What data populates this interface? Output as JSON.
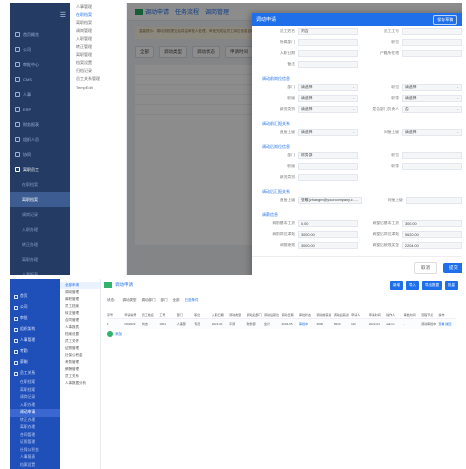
{
  "top": {
    "sidebar": {
      "items": [
        {
          "label": "首页概览"
        },
        {
          "label": "公司"
        },
        {
          "label": "审批中心"
        },
        {
          "label": "CMS"
        },
        {
          "label": "人事"
        },
        {
          "label": "ERP"
        },
        {
          "label": "财务报表"
        },
        {
          "label": "组织人员"
        },
        {
          "label": "协同"
        },
        {
          "label": "离职员工"
        }
      ],
      "subitems": [
        {
          "label": "在职档案"
        },
        {
          "label": "离职档案"
        },
        {
          "label": "调岗记录"
        },
        {
          "label": "入职办理"
        },
        {
          "label": "转正办理"
        },
        {
          "label": "离职办理"
        },
        {
          "label": "人事报表"
        },
        {
          "label": "合同管理"
        },
        {
          "label": "证照管理"
        },
        {
          "label": "社保公积金"
        },
        {
          "label": "考勤管理"
        }
      ]
    },
    "submenu": [
      "人事管理",
      "在职档案",
      "离职档案",
      "调岗管理",
      "入职管理",
      "转正管理",
      "离职管理",
      "档案设置",
      "归档记录",
      "员工关系管理",
      "TempEdit"
    ],
    "tabs": [
      {
        "label": "调动申请"
      },
      {
        "label": "任务流程"
      },
      {
        "label": "调岗管理"
      }
    ],
    "notice": "温馨提示：调动流程提交后将由审批人处理，审批完成后员工岗位信息自动更新，如需修改请撤回后重新提交。",
    "filters": [
      "全部",
      "调动类型",
      "调动状态",
      "申请时间"
    ],
    "drawer": {
      "title": "调动申请",
      "header_button": "保存草稿",
      "close": "✕",
      "top_fields": [
        {
          "label": "员工姓名",
          "value": "刘吉",
          "label2": "员工工号",
          "value2": ""
        },
        {
          "label": "所属部门",
          "value": "",
          "label2": "职位",
          "value2": ""
        },
        {
          "label": "入职日期",
          "value": "",
          "label2": "户籍所在地",
          "value2": ""
        },
        {
          "label": "备注",
          "value": "",
          "label2": "",
          "value2": ""
        }
      ],
      "sections": [
        {
          "title": "调动前岗位信息",
          "rows": [
            {
              "label": "部门",
              "value": "请选择",
              "select": true,
              "label2": "职位",
              "value2": "请选择",
              "select2": true
            },
            {
              "label": "职级",
              "value": "请选择",
              "select": true,
              "label2": "职等",
              "value2": "请选择",
              "select2": true
            },
            {
              "label": "薪资类别",
              "value": "请选择",
              "select": true,
              "label2": "是否部门负责人",
              "value2": "否",
              "select2": true
            }
          ]
        },
        {
          "title": "调动前汇报关系",
          "rows": [
            {
              "label": "直接上级",
              "value": "请选择",
              "select": true,
              "label2": "间接上级",
              "value2": "请选择",
              "select2": true
            }
          ]
        },
        {
          "title": "调动后岗位信息",
          "rows": [
            {
              "label": "部门",
              "value": "财务部",
              "select": false,
              "label2": "职位",
              "value2": "",
              "select2": false
            },
            {
              "label": "职级",
              "value": "",
              "select": false,
              "label2": "职等",
              "value2": "",
              "select2": false
            },
            {
              "label": "薪资类别",
              "value": "",
              "select": false,
              "label2": "",
              "value2": "",
              "select2": false
            }
          ]
        },
        {
          "title": "调动后汇报关系",
          "rows": [
            {
              "label": "直接上级",
              "value": "张敏(zhangm@yourcompany.c...",
              "select": true,
              "label2": "间接上级",
              "value2": "",
              "select2": false
            }
          ]
        },
        {
          "title": "调薪信息",
          "rows": [
            {
              "label": "调前基本工资",
              "value": "0.00",
              "select": false,
              "label2": "调整后基本工资",
              "value2": "300.00",
              "select2": false
            },
            {
              "label": "调前岗位津贴",
              "value": "3000.00",
              "select": false,
              "label2": "调整后岗位津贴",
              "value2": "5620.00",
              "select2": false
            },
            {
              "label": "调前绩效",
              "value": "3000.00",
              "select": false,
              "label2": "调整后绩效奖金",
              "value2": "2204.00",
              "select2": false
            }
          ]
        }
      ],
      "cancel": "取消",
      "confirm": "提交"
    }
  },
  "bottom": {
    "sidebar": {
      "items": [
        {
          "label": "首页"
        },
        {
          "label": "公司"
        },
        {
          "label": "审批"
        },
        {
          "label": "组织架构"
        },
        {
          "label": "人事管理"
        },
        {
          "label": "考勤"
        },
        {
          "label": "薪酬"
        },
        {
          "label": "员工关系"
        }
      ],
      "subitems": [
        {
          "label": "在职档案"
        },
        {
          "label": "离职档案"
        },
        {
          "label": "调岗记录"
        },
        {
          "label": "入职办理"
        },
        {
          "label": "调动申请",
          "active": true
        },
        {
          "label": "转正办理"
        },
        {
          "label": "离职办理"
        },
        {
          "label": "合同管理"
        },
        {
          "label": "证照管理"
        },
        {
          "label": "社保公积金"
        },
        {
          "label": "人事报表"
        },
        {
          "label": "档案设置"
        },
        {
          "label": "员工关怀"
        },
        {
          "label": "员工"
        }
      ]
    },
    "submenu": [
      "全部申请",
      "调岗管理",
      "离职管理",
      "员工档案",
      "转正管理",
      "合同管理",
      "人事报表",
      "档案设置",
      "员工关怀",
      "证照管理",
      "社保公积金",
      "考勤管理",
      "薪酬管理",
      "员工关系",
      "人事数据分析"
    ],
    "title": "调动申请",
    "actions": [
      "新增",
      "导入",
      "导出数据",
      "批量"
    ],
    "filters": [
      "状态：",
      "调动类型",
      "调动部门",
      "部门",
      "全部",
      "已选条件"
    ],
    "table_head": [
      "序号",
      "申请编号",
      "员工姓名",
      "工号",
      "部门",
      "职位",
      "入职日期",
      "调动类型",
      "调动后部门",
      "调动后职位",
      "调动日期",
      "审批状态",
      "调动前薪资",
      "调动后薪资",
      "申请人",
      "申请时间",
      "操作人",
      "审批时间",
      "流程节点",
      "操作"
    ],
    "table_row": [
      "1",
      "DD2023",
      "刘吉",
      "1001",
      "人事部",
      "专员",
      "2021-01",
      "平调",
      "财务部",
      "会计",
      "2023-05",
      "审批中",
      "3000",
      "5620",
      "HR",
      "2023-04",
      "admin",
      "-",
      "调动审批中",
      "查看  撤回"
    ],
    "add_label": "添加"
  }
}
